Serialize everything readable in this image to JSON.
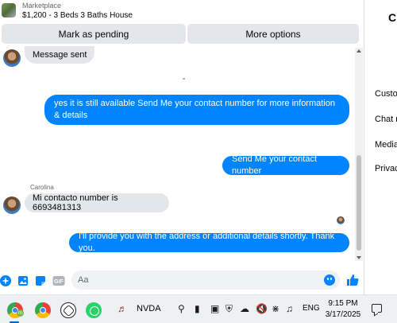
{
  "header": {
    "marketplace_label": "Marketplace",
    "listing_title": "$1,200 - 3 Beds 3 Baths House",
    "mark_pending_label": "Mark as pending",
    "more_options_label": "More options"
  },
  "messages": {
    "system_sent": "Message sent",
    "out_1": "yes it is still available Send Me your contact number for more information & details",
    "out_2": "Send Me your contact number",
    "sender_name": "Carolina",
    "in_1": "Mi contacto number is 6693481313",
    "out_3": "I'll provide you with the address or additional details shortly. Thank you."
  },
  "composer": {
    "placeholder": "Aa",
    "icons": [
      "plus-icon",
      "photo-icon",
      "sticker-icon",
      "gif-icon",
      "emoji-icon",
      "like-icon"
    ]
  },
  "right_pane": {
    "title": "C",
    "items": [
      "Custo",
      "Chat r",
      "Media",
      "Privac"
    ]
  },
  "taskbar": {
    "nvda_label": "NVDA",
    "language": "ENG",
    "time": "9:15 PM",
    "date": "3/17/2025",
    "badge_letter": "m"
  },
  "colors": {
    "accent": "#0084ff",
    "incoming_bubble": "#e4e6eb",
    "button_bg": "#e4e6eb"
  }
}
